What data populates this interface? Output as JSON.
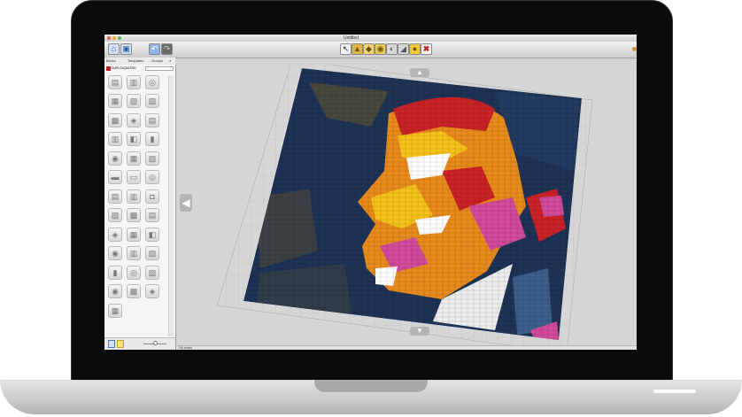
{
  "window": {
    "title": "Untitled"
  },
  "toolbar": {
    "left_icons": [
      "home-icon",
      "save-icon",
      "undo-icon",
      "redo-icon"
    ],
    "tools": [
      "select-icon",
      "paint-icon",
      "clone-icon",
      "hinge-icon",
      "flex-icon",
      "paint-bucket-icon",
      "hide-icon",
      "delete-icon"
    ]
  },
  "tabs": [
    "Bricks",
    "Templates",
    "Groups"
  ],
  "category": "DUPLO/QUATRO",
  "status_text": "768 bricks",
  "colors": {
    "accent_red": "#c0202a",
    "navy": "#1e3356",
    "mosaic_red": "#c82126",
    "mosaic_orange": "#e88a1c",
    "mosaic_yellow": "#f5c21a",
    "mosaic_pink": "#d14a9b"
  }
}
